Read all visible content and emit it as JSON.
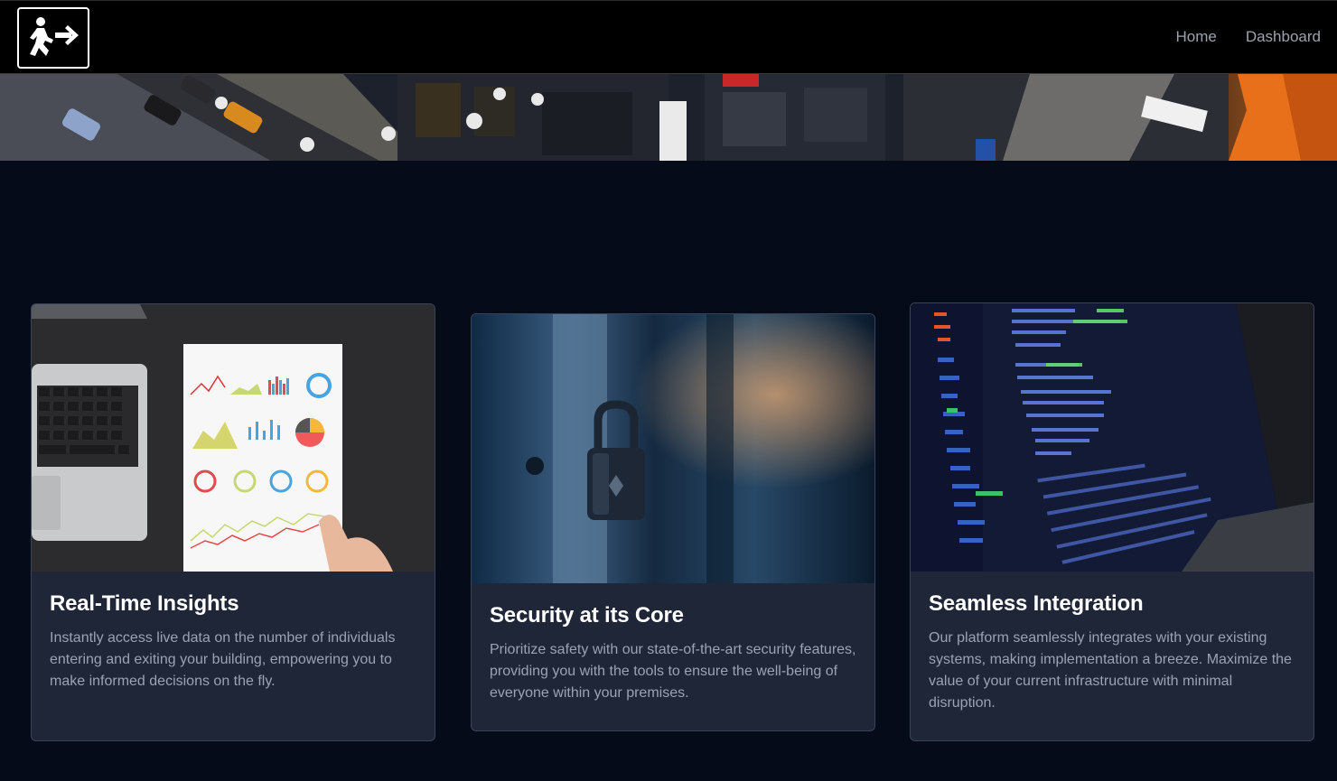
{
  "nav": {
    "logo_icon": "exit-walk-icon",
    "links": [
      {
        "label": "Home"
      },
      {
        "label": "Dashboard"
      }
    ]
  },
  "banner": {
    "alt": "city-street-aerial-image"
  },
  "cards": [
    {
      "title": "Real-Time Insights",
      "text": "Instantly access live data on the number of individuals entering and exiting your building, empowering you to make informed decisions on the fly.",
      "image": "laptop-and-charts-image"
    },
    {
      "title": "Security at its Core",
      "text": "Prioritize safety with our state-of-the-art security features, providing you with the tools to ensure the well-being of everyone within your premises.",
      "image": "padlock-image"
    },
    {
      "title": "Seamless Integration",
      "text": "Our platform seamlessly integrates with your existing systems, making implementation a breeze. Maximize the value of your current infrastructure with minimal disruption.",
      "image": "code-on-laptop-image"
    }
  ],
  "colors": {
    "background": "#050b18",
    "nav": "#000000",
    "card": "#1e2637",
    "title": "#ffffff",
    "body_text": "#9aa3b3",
    "nav_link": "#9ca3af"
  }
}
